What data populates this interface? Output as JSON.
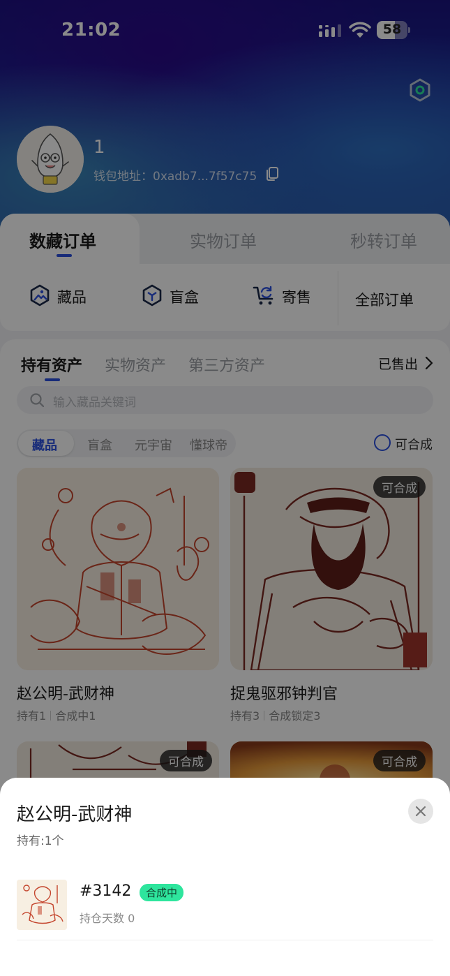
{
  "status_bar": {
    "time": "21:02",
    "battery": "58",
    "battery_level": 0.58
  },
  "profile": {
    "username": "1",
    "wallet_label": "钱包地址：0xadb7...7f57c75"
  },
  "order_tabs": [
    "数藏订单",
    "实物订单",
    "秒转订单"
  ],
  "order_items": [
    {
      "label": "藏品",
      "icon": "collection-icon"
    },
    {
      "label": "盲盒",
      "icon": "blind-box-icon"
    },
    {
      "label": "寄售",
      "icon": "consign-cart-icon"
    }
  ],
  "all_orders": "全部订单",
  "asset_tabs": [
    "持有资产",
    "实物资产",
    "第三方资产"
  ],
  "sold_link": "已售出",
  "search": {
    "placeholder": "输入藏品关键词"
  },
  "categories": [
    "藏品",
    "盲盒",
    "元宇宙",
    "懂球帝"
  ],
  "synth_toggle_label": "可合成",
  "cards": [
    {
      "title": "赵公明-武财神",
      "held": "持有1",
      "status": "合成中1",
      "badge": ""
    },
    {
      "title": "捉鬼驱邪钟判官",
      "held": "持有3",
      "status": "合成锁定3",
      "badge": "可合成"
    },
    {
      "title": "",
      "held": "",
      "status": "",
      "badge": "可合成"
    },
    {
      "title": "",
      "held": "",
      "status": "",
      "badge": "可合成"
    }
  ],
  "sheet": {
    "title": "赵公明-武财神",
    "subtitle": "持有:1个",
    "item_number": "#3142",
    "item_status": "合成中",
    "item_days": "持仓天数 0"
  },
  "colors": {
    "accent": "#2b50e0",
    "status_green": "#2ee59d",
    "art_red": "#c4452d"
  }
}
